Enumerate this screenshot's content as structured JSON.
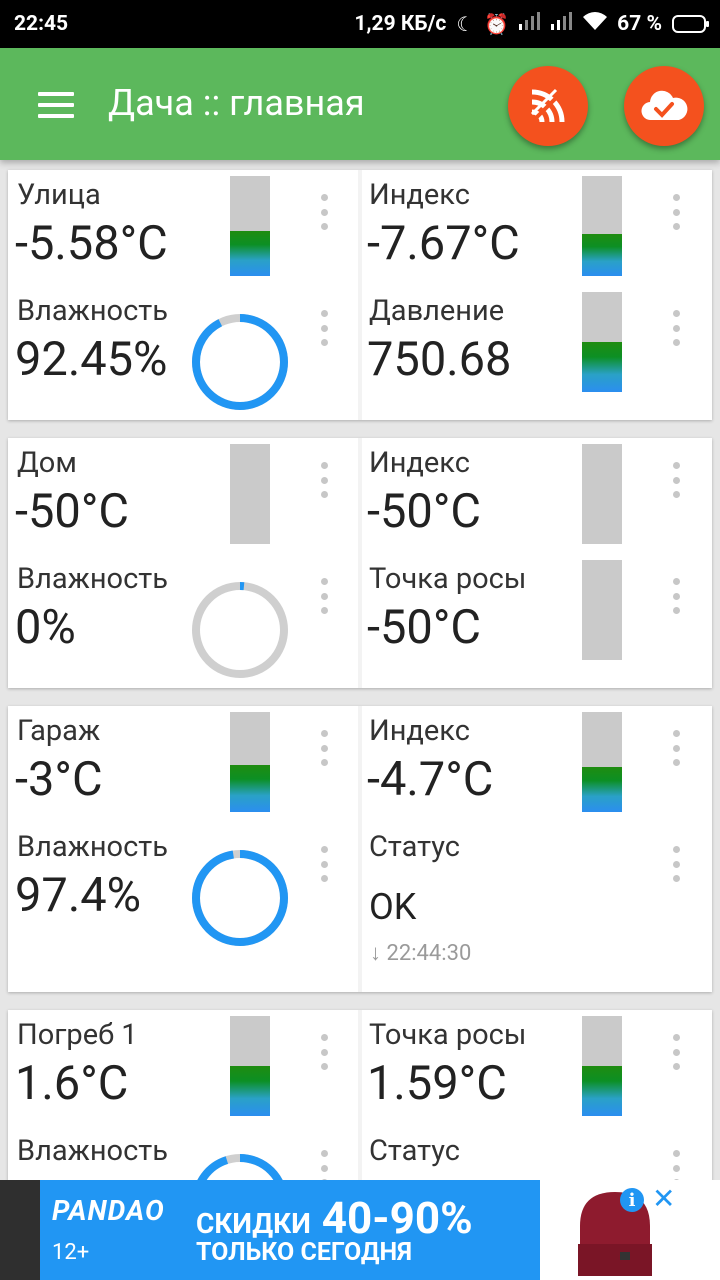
{
  "status_bar": {
    "time": "22:45",
    "net_speed": "1,29 КБ/с",
    "battery": "67 %",
    "battery_level": 0.67,
    "icons": [
      "moon-icon",
      "alarm-icon",
      "signal-icon",
      "signal-icon",
      "wifi-icon",
      "battery-icon"
    ]
  },
  "app_bar": {
    "title": "Дача :: главная",
    "icons": [
      "menu-icon",
      "wifi-off-icon",
      "cloud-check-icon"
    ],
    "fab_color": "#f4511e",
    "bar_color": "#5cb85c"
  },
  "cards": [
    {
      "cells": [
        {
          "label": "Улица",
          "value": "-5.58°C",
          "indicator": "bar",
          "level": 0.45
        },
        {
          "label": "Индекс",
          "value": "-7.67°C",
          "indicator": "bar",
          "level": 0.42
        },
        {
          "label": "Влажность",
          "value": "92.45%",
          "indicator": "ring",
          "level": 0.9245
        },
        {
          "label": "Давление",
          "value": "750.68",
          "indicator": "bar",
          "level": 0.5
        }
      ]
    },
    {
      "cells": [
        {
          "label": "Дом",
          "value": "-50°C",
          "indicator": "bar",
          "level": 0
        },
        {
          "label": "Индекс",
          "value": "-50°C",
          "indicator": "bar",
          "level": 0
        },
        {
          "label": "Влажность",
          "value": "0%",
          "indicator": "ring",
          "level": 0.0
        },
        {
          "label": "Точка росы",
          "value": "-50°C",
          "indicator": "bar",
          "level": 0
        }
      ]
    },
    {
      "cells": [
        {
          "label": "Гараж",
          "value": "-3°C",
          "indicator": "bar",
          "level": 0.47
        },
        {
          "label": "Индекс",
          "value": "-4.7°C",
          "indicator": "bar",
          "level": 0.45
        },
        {
          "label": "Влажность",
          "value": "97.4%",
          "indicator": "ring",
          "level": 0.974
        },
        {
          "label": "Статус",
          "value": "OK",
          "time": "22:44:30",
          "indicator": "status"
        }
      ]
    },
    {
      "cells": [
        {
          "label": "Погреб 1",
          "value": "1.6°C",
          "indicator": "bar",
          "level": 0.5
        },
        {
          "label": "Точка росы",
          "value": "1.59°C",
          "indicator": "bar",
          "level": 0.5
        },
        {
          "label": "Влажность",
          "value": "",
          "indicator": "ring",
          "level": 0.95
        },
        {
          "label": "Статус",
          "value": "",
          "indicator": "status"
        }
      ]
    }
  ],
  "ad": {
    "brand": "PANDAO",
    "age": "12+",
    "headline_prefix": "СКИДКИ",
    "headline": "40-90%",
    "subline": "ТОЛЬКО СЕГОДНЯ",
    "info": "i",
    "close": "✕"
  },
  "colors": {
    "ring_fill": "#2196f3",
    "ring_track": "#cfcfcf",
    "bar_track": "#cacaca",
    "ad_blue": "#2196f3"
  }
}
